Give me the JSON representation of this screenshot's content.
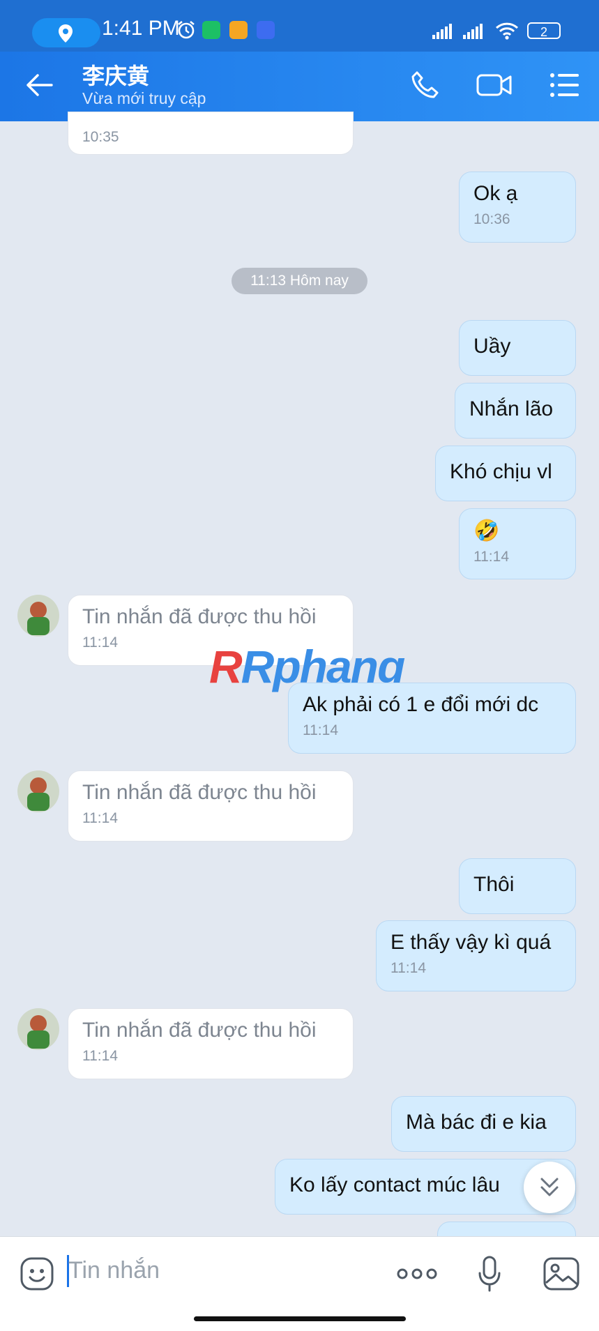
{
  "status_bar": {
    "time": "1:41 PM",
    "battery": "2"
  },
  "header": {
    "title": "李庆黄",
    "subtitle": "Vừa mới truy cập"
  },
  "date_separator": "11:13 Hôm nay",
  "messages": [
    {
      "dir": "in",
      "text": "",
      "time": "10:35"
    },
    {
      "dir": "out",
      "text": "Ok ạ",
      "time": "10:36"
    },
    {
      "dir": "out",
      "text": "Uầy",
      "time": ""
    },
    {
      "dir": "out",
      "text": "Nhắn lão",
      "time": ""
    },
    {
      "dir": "out",
      "text": "Khó chịu vl",
      "time": ""
    },
    {
      "dir": "out",
      "text": "🤣",
      "time": "11:14"
    },
    {
      "dir": "in",
      "text": "Tin nhắn đã được thu hồi",
      "time": "11:14"
    },
    {
      "dir": "out",
      "text": "Ak phải có 1 e đổi mới dc",
      "time": "11:14"
    },
    {
      "dir": "in",
      "text": "Tin nhắn đã được thu hồi",
      "time": "11:14"
    },
    {
      "dir": "out",
      "text": "Thôi",
      "time": ""
    },
    {
      "dir": "out",
      "text": "E thấy vậy kì quá",
      "time": "11:14"
    },
    {
      "dir": "in",
      "text": "Tin nhắn đã được thu hồi",
      "time": "11:14"
    },
    {
      "dir": "out",
      "text": "Mà bác đi e kia",
      "time": ""
    },
    {
      "dir": "out",
      "text": "Ko lấy contact múc lâu",
      "time": ""
    }
  ],
  "watermark": "Rphang",
  "input": {
    "placeholder": "Tin nhắn"
  },
  "icons": {
    "back": "arrow-left-icon",
    "call": "phone-icon",
    "video": "video-camera-icon",
    "menu": "list-menu-icon",
    "sticker": "emoji-icon",
    "more": "more-dots-icon",
    "mic": "microphone-icon",
    "image": "image-icon",
    "scroll": "chevron-double-down-icon"
  },
  "colors": {
    "header": "#2f93f6",
    "outgoing_bubble": "#d4ecfe",
    "incoming_bubble": "#ffffff",
    "background": "#e2e8f1"
  }
}
